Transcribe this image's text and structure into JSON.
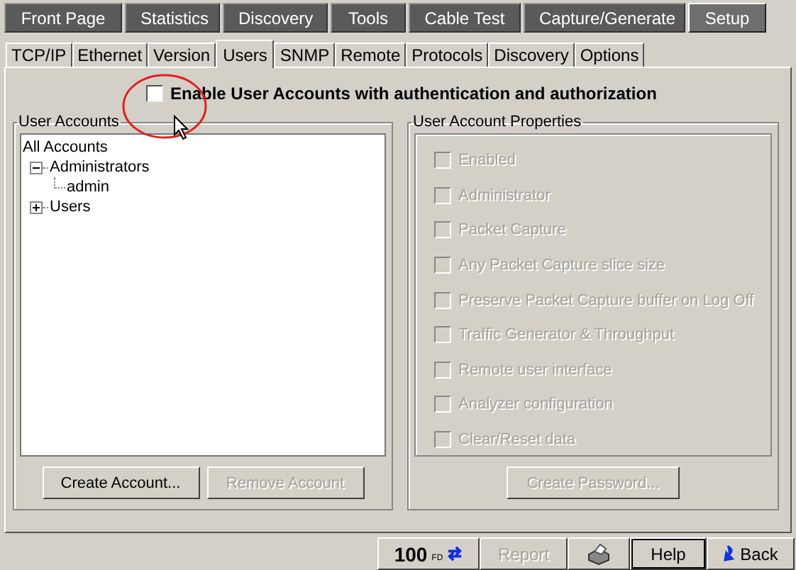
{
  "main_tabs": [
    {
      "label": "Front Page",
      "selected": false
    },
    {
      "label": "Statistics",
      "selected": false
    },
    {
      "label": "Discovery",
      "selected": false
    },
    {
      "label": "Tools",
      "selected": false
    },
    {
      "label": "Cable Test",
      "selected": false
    },
    {
      "label": "Capture/Generate",
      "selected": false
    },
    {
      "label": "Setup",
      "selected": true
    }
  ],
  "sub_tabs": [
    {
      "label": "TCP/IP",
      "selected": false
    },
    {
      "label": "Ethernet",
      "selected": false
    },
    {
      "label": "Version",
      "selected": false
    },
    {
      "label": "Users",
      "selected": true
    },
    {
      "label": "SNMP",
      "selected": false
    },
    {
      "label": "Remote",
      "selected": false
    },
    {
      "label": "Protocols",
      "selected": false
    },
    {
      "label": "Discovery",
      "selected": false
    },
    {
      "label": "Options",
      "selected": false
    }
  ],
  "enable_option": {
    "label": "Enable User Accounts with authentication and authorization",
    "checked": false
  },
  "user_accounts": {
    "title": "User Accounts",
    "tree": [
      {
        "label": "All Accounts",
        "children": [
          {
            "label": "Administrators",
            "expanded": true,
            "children": [
              {
                "label": "admin"
              }
            ]
          },
          {
            "label": "Users",
            "expanded": false
          }
        ]
      }
    ],
    "buttons": [
      {
        "label": "Create Account...",
        "disabled": false
      },
      {
        "label": "Remove Account",
        "disabled": true
      }
    ]
  },
  "properties": {
    "title": "User Account Properties",
    "options": [
      {
        "label": "Enabled",
        "checked": false,
        "disabled": true
      },
      {
        "label": "Administrator",
        "checked": false,
        "disabled": true
      },
      {
        "label": "Packet Capture",
        "checked": false,
        "disabled": true
      },
      {
        "label": "Any Packet Capture slice size",
        "checked": false,
        "disabled": true
      },
      {
        "label": "Preserve Packet Capture buffer on Log Off",
        "checked": false,
        "disabled": true
      },
      {
        "label": "Traffic Generator & Throughput",
        "checked": false,
        "disabled": true
      },
      {
        "label": "Remote user interface",
        "checked": false,
        "disabled": true
      },
      {
        "label": "Analyzer configuration",
        "checked": false,
        "disabled": true
      },
      {
        "label": "Clear/Reset data",
        "checked": false,
        "disabled": true
      }
    ],
    "button": {
      "label": "Create Password...",
      "disabled": true
    }
  },
  "footer": {
    "speed": "100",
    "duplex": "FD",
    "report": {
      "label": "Report",
      "disabled": true
    },
    "help": "Help",
    "back": "Back"
  }
}
